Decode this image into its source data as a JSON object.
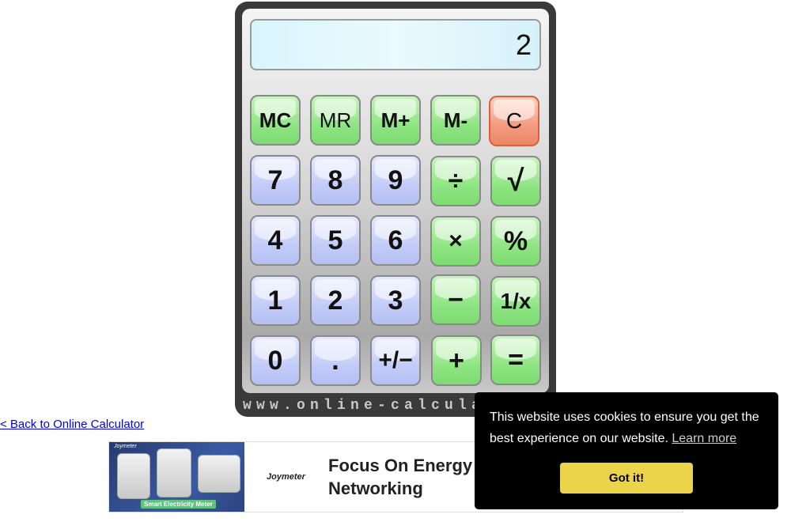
{
  "calculator": {
    "display_value": "2",
    "brand_text": "www.online-calculator.com",
    "keys": {
      "mc": "MC",
      "mr": "MR",
      "mplus": "M+",
      "mminus": "M-",
      "clear": "C",
      "seven": "7",
      "eight": "8",
      "nine": "9",
      "divide": "÷",
      "sqrt": "√",
      "four": "4",
      "five": "5",
      "six": "6",
      "multiply": "×",
      "percent": "%",
      "one": "1",
      "two": "2",
      "three": "3",
      "minus": "−",
      "reciprocal": "1/x",
      "zero": "0",
      "decimal": ".",
      "plus_minus": "+/−",
      "plus": "+",
      "equals": "="
    }
  },
  "back_link": "< Back to Online Calculator",
  "ad": {
    "image_brand": "Joymeter",
    "image_caption": "Smart Electricity Meter",
    "logo": "Joymeter",
    "headline": "Focus On Energy Networking"
  },
  "cookie_banner": {
    "message": "This website uses cookies to ensure you get the best experience on our website.",
    "learn_more": "Learn more",
    "accept": "Got it!"
  },
  "colors": {
    "green_key": "#8fe583",
    "blue_key": "#c3ccf7",
    "clear_key": "#f39a80",
    "cookie_button": "#ecd44a",
    "cookie_background": "#000000"
  }
}
